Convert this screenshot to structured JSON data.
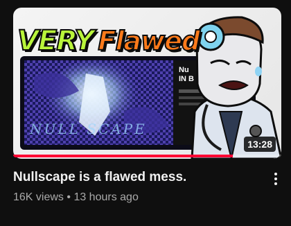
{
  "video": {
    "thumbnail": {
      "headline_word1": "VERY",
      "headline_word2": "Flawed",
      "inner_text": "NULL SCAPE",
      "inner_sidebar_title": "Nu\nIN B",
      "duration": "13:28",
      "watch_progress": 0.82
    },
    "title": "Nullscape is a flawed mess.",
    "views": "16K views",
    "separator": "•",
    "age": "13 hours ago"
  },
  "colors": {
    "page_background": "#0f0f0f",
    "title_text": "#f1f1f1",
    "meta_text": "#aaaaaa",
    "progress_red": "#ff0033",
    "headline_green": "#b9f53a",
    "headline_orange": "#ff7a1a"
  },
  "icons": {
    "more_menu": "three-vertical-dots-icon"
  }
}
